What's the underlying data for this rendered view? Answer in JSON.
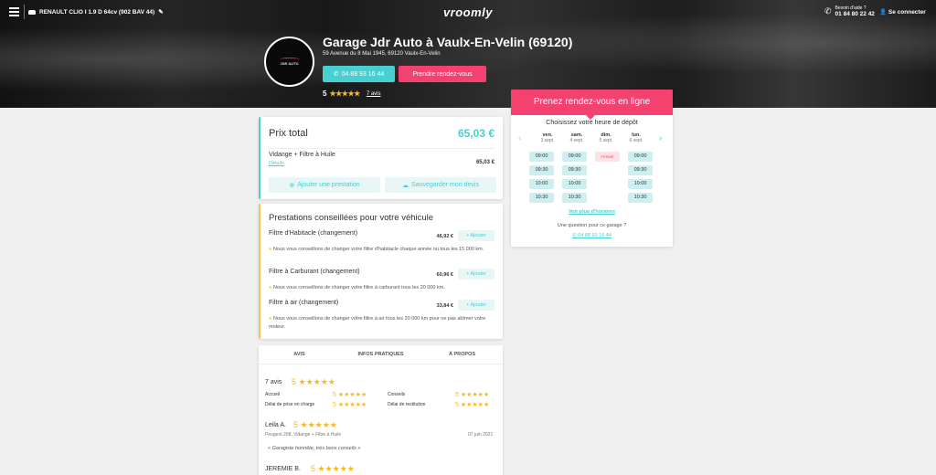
{
  "topbar": {
    "vehicle": "RENAULT CLIO I 1.9 D 64cv (902 BAV 44)",
    "logo": "vroomly",
    "help_label": "Besoin d'aide ?",
    "help_number": "01 84 80 22 42",
    "connect": "Se connecter"
  },
  "garage": {
    "title": "Garage Jdr Auto à Vaulx-En-Velin (69120)",
    "address": "59 Avenue du 8 Mai 1945, 69120 Vaulx-En-Velin",
    "phone_button": "04 88 93 16 44",
    "appointment_button": "Prendre rendez-vous",
    "rating": "5",
    "stars": "★★★★★",
    "reviews_link": "7 avis",
    "logo_text": "JDR AUTO"
  },
  "price": {
    "title": "Prix total",
    "total": "65,03 €",
    "service": "Vidange + Filtre à Huile",
    "details": "Détails",
    "service_price": "65,03 €",
    "add_service": "Ajouter une prestation",
    "save_quote": "Sauvegarder mon devis"
  },
  "recommended": {
    "title": "Prestations conseillées pour votre véhicule",
    "add_label": "+ Ajouter",
    "items": [
      {
        "name": "Filtre d'Habitacle (changement)",
        "price": "46,92 €",
        "note": "Nous vous conseillons de changer votre filtre d'habitacle chaque année ou tous les 15 000 km."
      },
      {
        "name": "Filtre à Carburant (changement)",
        "price": "60,96 €",
        "note": "Nous vous conseillons de changer votre filtre à carburant tous les 20 000 km."
      },
      {
        "name": "Filtre à air (changement)",
        "price": "33,84 €",
        "note": "Nous vous conseillons de changer votre filtre à air tous les 20 000 km pour ne pas abîmer votre moteur."
      }
    ]
  },
  "reviews": {
    "tabs": [
      "AVIS",
      "INFOS PRATIQUES",
      "À PROPOS"
    ],
    "count": "7 avis",
    "overall": "5",
    "stars": "★★★★★",
    "criteria": [
      {
        "label": "Accueil",
        "score": "5"
      },
      {
        "label": "Conseils",
        "score": "5"
      },
      {
        "label": "Délai de prise en charge",
        "score": "5"
      },
      {
        "label": "Délai de restitution",
        "score": "5"
      }
    ],
    "items": [
      {
        "author": "Leila A.",
        "score": "5",
        "vehicle": "Peugeot 208, Vidange + Filtre à Huile",
        "date": "07 juin 2021",
        "comment": "« Garagiste honnête, très bons conseils »"
      },
      {
        "author": "JEREMIE B.",
        "score": "5"
      }
    ]
  },
  "booking": {
    "title": "Prenez rendez-vous en ligne",
    "subtitle": "Choisissez votre heure de dépôt",
    "days": [
      {
        "name": "ven.",
        "date": "3 sept.",
        "slots": [
          "09:00",
          "09:30",
          "10:00",
          "10:30"
        ]
      },
      {
        "name": "sam.",
        "date": "4 sept.",
        "slots": [
          "09:00",
          "09:30",
          "10:00",
          "10:30"
        ]
      },
      {
        "name": "dim.",
        "date": "5 sept.",
        "closed": "FERMÉ"
      },
      {
        "name": "lun.",
        "date": "6 sept.",
        "slots": [
          "09:00",
          "09:30",
          "10:00",
          "10:30"
        ]
      }
    ],
    "more_hours": "Voir plus d'horaires",
    "question": "Une question pour ce garage ?",
    "phone": "04 88 93 16 44",
    "prev_icon": "‹",
    "next_icon": "›"
  },
  "colors": {
    "accent": "#47cfd1",
    "brand": "#f3426f",
    "star": "#f6b82a"
  }
}
